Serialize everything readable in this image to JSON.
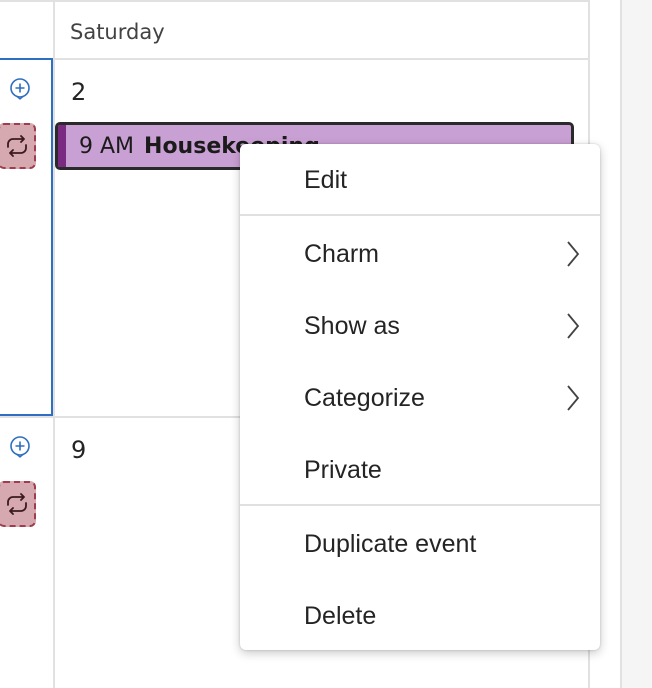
{
  "calendar": {
    "day_header": "Saturday",
    "week1_date": "2",
    "week2_date": "9"
  },
  "event": {
    "time": "9 AM",
    "title": "Housekeeping",
    "color": "#c9a0d3",
    "accent": "#7a2b81"
  },
  "context_menu": {
    "items": [
      {
        "label": "Edit",
        "submenu": false
      },
      {
        "label": "Charm",
        "submenu": true
      },
      {
        "label": "Show as",
        "submenu": true
      },
      {
        "label": "Categorize",
        "submenu": true
      },
      {
        "label": "Private",
        "submenu": false
      },
      {
        "label": "Duplicate event",
        "submenu": false
      },
      {
        "label": "Delete",
        "submenu": false
      }
    ]
  },
  "icons": {
    "add": "add-event-icon",
    "recurring": "recurring-icon",
    "submenu": "chevron-right-icon"
  }
}
